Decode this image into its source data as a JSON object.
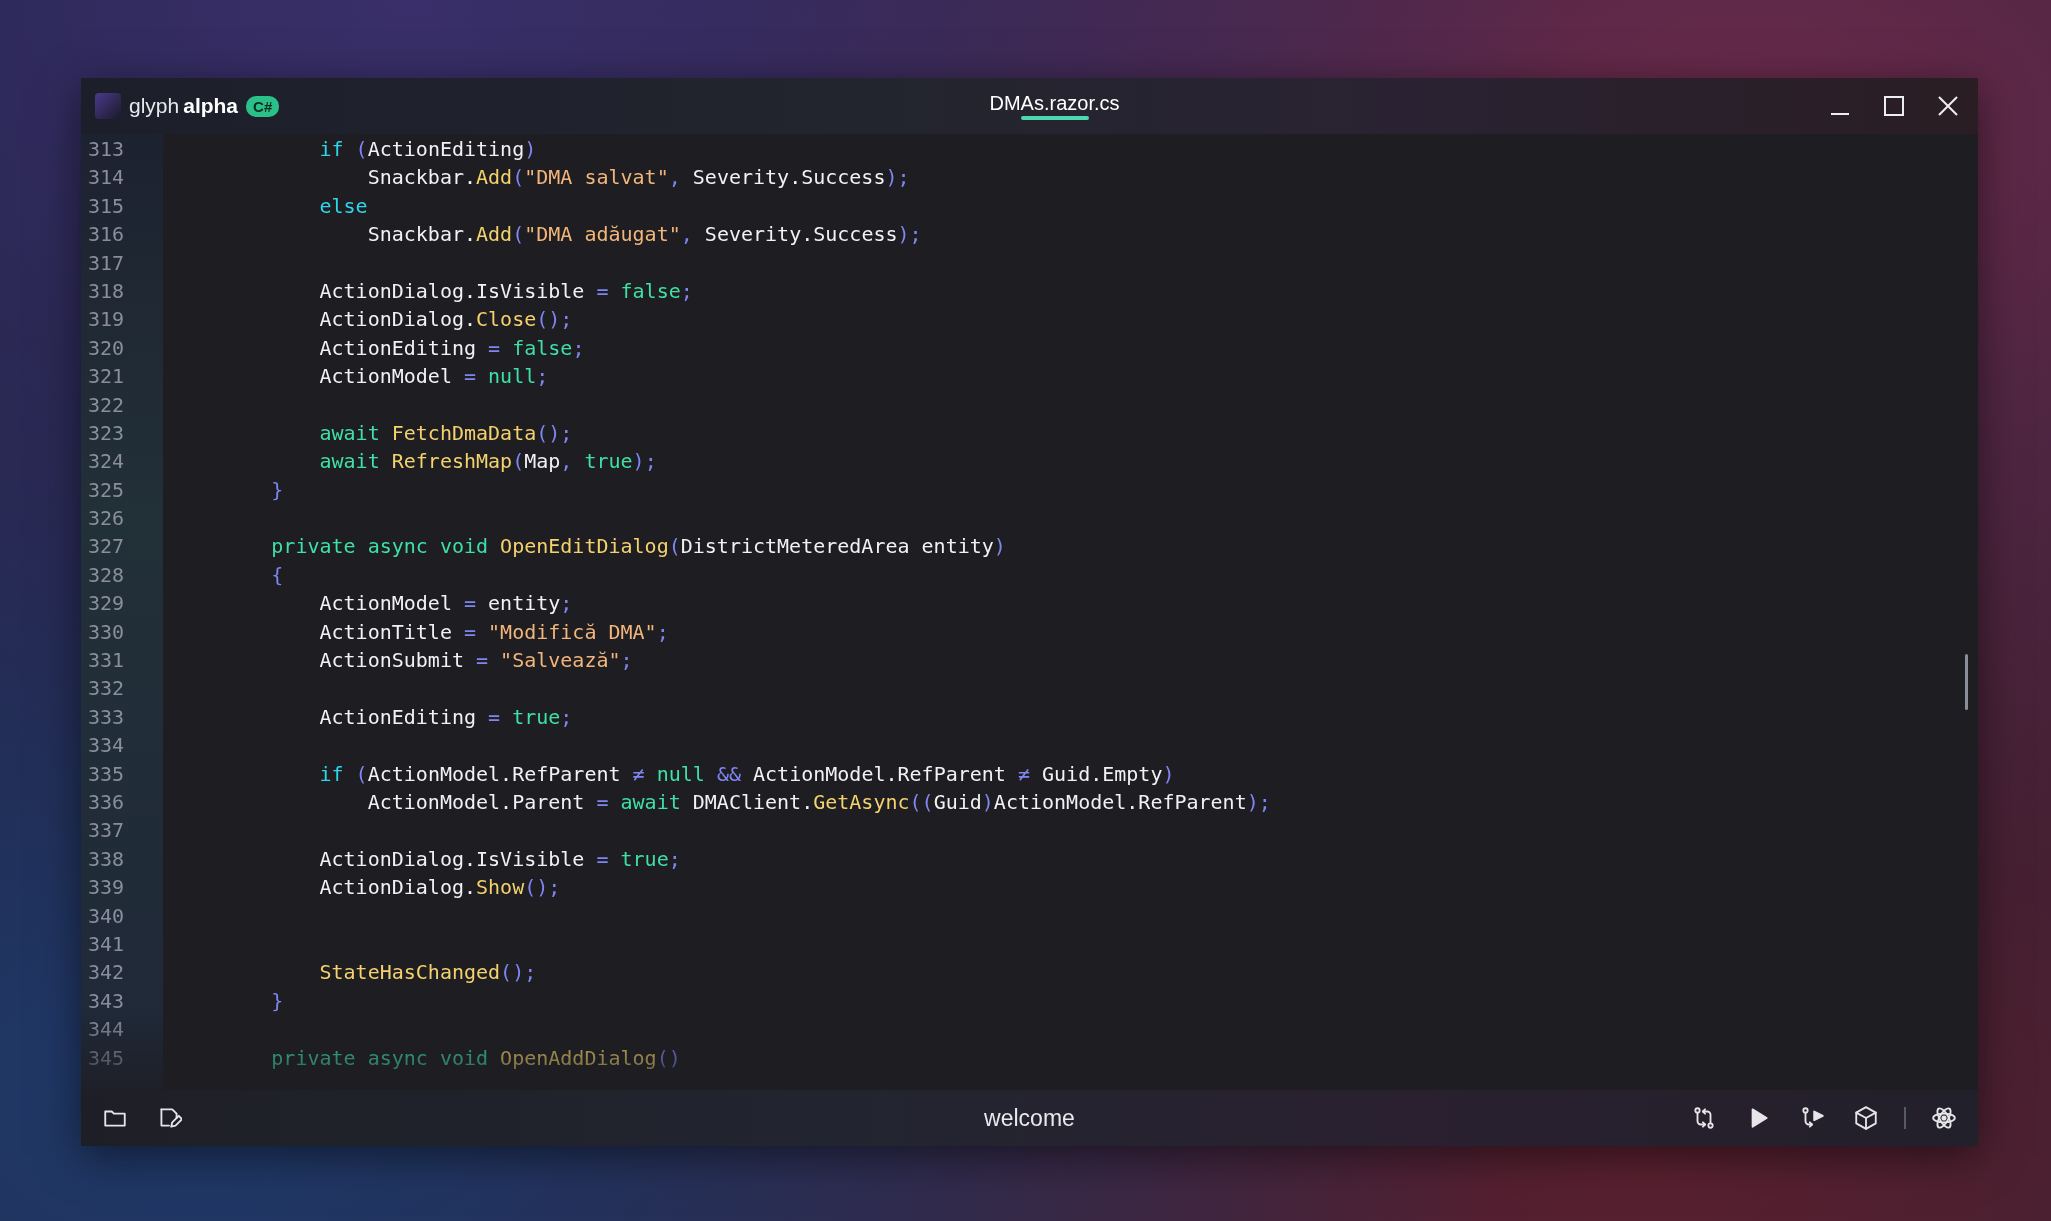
{
  "window": {
    "brand_name": "glyph",
    "brand_suffix": "alpha",
    "language_badge": "C#"
  },
  "tabs": [
    {
      "label": "DMAs.razor.cs",
      "selected": true
    }
  ],
  "code_lines": [
    {
      "number": "313",
      "tokens": [
        {
          "kind": "kw",
          "text": "            if"
        },
        {
          "kind": "punc",
          "text": " ("
        },
        {
          "kind": "plain",
          "text": "ActionEditing"
        },
        {
          "kind": "punc",
          "text": ")"
        }
      ]
    },
    {
      "number": "314",
      "tokens": [
        {
          "kind": "plain",
          "text": "                Snackbar."
        },
        {
          "kind": "fn",
          "text": "Add"
        },
        {
          "kind": "punc",
          "text": "("
        },
        {
          "kind": "str",
          "text": "\"DMA salvat\""
        },
        {
          "kind": "punc",
          "text": ", "
        },
        {
          "kind": "plain",
          "text": "Severity.Success"
        },
        {
          "kind": "punc",
          "text": ");"
        }
      ]
    },
    {
      "number": "315",
      "tokens": [
        {
          "kind": "kw",
          "text": "            else"
        }
      ]
    },
    {
      "number": "316",
      "tokens": [
        {
          "kind": "plain",
          "text": "                Snackbar."
        },
        {
          "kind": "fn",
          "text": "Add"
        },
        {
          "kind": "punc",
          "text": "("
        },
        {
          "kind": "str",
          "text": "\"DMA adăugat\""
        },
        {
          "kind": "punc",
          "text": ", "
        },
        {
          "kind": "plain",
          "text": "Severity.Success"
        },
        {
          "kind": "punc",
          "text": ");"
        }
      ]
    },
    {
      "number": "317"
    },
    {
      "number": "318",
      "tokens": [
        {
          "kind": "plain",
          "text": "            ActionDialog.IsVisible"
        },
        {
          "kind": "punc",
          "text": " = "
        },
        {
          "kind": "lit",
          "text": "false"
        },
        {
          "kind": "punc",
          "text": ";"
        }
      ]
    },
    {
      "number": "319",
      "tokens": [
        {
          "kind": "plain",
          "text": "            ActionDialog."
        },
        {
          "kind": "fn",
          "text": "Close"
        },
        {
          "kind": "punc",
          "text": "();"
        }
      ]
    },
    {
      "number": "320",
      "tokens": [
        {
          "kind": "plain",
          "text": "            ActionEditing"
        },
        {
          "kind": "punc",
          "text": " = "
        },
        {
          "kind": "lit",
          "text": "false"
        },
        {
          "kind": "punc",
          "text": ";"
        }
      ]
    },
    {
      "number": "321",
      "tokens": [
        {
          "kind": "plain",
          "text": "            ActionModel"
        },
        {
          "kind": "punc",
          "text": " = "
        },
        {
          "kind": "lit",
          "text": "null"
        },
        {
          "kind": "punc",
          "text": ";"
        }
      ]
    },
    {
      "number": "322"
    },
    {
      "number": "323",
      "tokens": [
        {
          "kind": "lit",
          "text": "            await "
        },
        {
          "kind": "fn",
          "text": "FetchDmaData"
        },
        {
          "kind": "punc",
          "text": "();"
        }
      ]
    },
    {
      "number": "324",
      "tokens": [
        {
          "kind": "lit",
          "text": "            await "
        },
        {
          "kind": "fn",
          "text": "RefreshMap"
        },
        {
          "kind": "punc",
          "text": "("
        },
        {
          "kind": "plain",
          "text": "Map"
        },
        {
          "kind": "punc",
          "text": ", "
        },
        {
          "kind": "lit",
          "text": "true"
        },
        {
          "kind": "punc",
          "text": ");"
        }
      ]
    },
    {
      "number": "325",
      "tokens": [
        {
          "kind": "punc",
          "text": "        }"
        }
      ]
    },
    {
      "number": "326"
    },
    {
      "number": "327",
      "tokens": [
        {
          "kind": "lit",
          "text": "        private async void "
        },
        {
          "kind": "fn",
          "text": "OpenEditDialog"
        },
        {
          "kind": "punc",
          "text": "("
        },
        {
          "kind": "plain",
          "text": "DistrictMeteredArea entity"
        },
        {
          "kind": "punc",
          "text": ")"
        }
      ]
    },
    {
      "number": "328",
      "tokens": [
        {
          "kind": "punc",
          "text": "        {"
        }
      ]
    },
    {
      "number": "329",
      "tokens": [
        {
          "kind": "plain",
          "text": "            ActionModel"
        },
        {
          "kind": "punc",
          "text": " = "
        },
        {
          "kind": "plain",
          "text": "entity"
        },
        {
          "kind": "punc",
          "text": ";"
        }
      ]
    },
    {
      "number": "330",
      "tokens": [
        {
          "kind": "plain",
          "text": "            ActionTitle"
        },
        {
          "kind": "punc",
          "text": " = "
        },
        {
          "kind": "str",
          "text": "\"Modifică DMA\""
        },
        {
          "kind": "punc",
          "text": ";"
        }
      ]
    },
    {
      "number": "331",
      "tokens": [
        {
          "kind": "plain",
          "text": "            ActionSubmit"
        },
        {
          "kind": "punc",
          "text": " = "
        },
        {
          "kind": "str",
          "text": "\"Salvează\""
        },
        {
          "kind": "punc",
          "text": ";"
        }
      ]
    },
    {
      "number": "332"
    },
    {
      "number": "333",
      "tokens": [
        {
          "kind": "plain",
          "text": "            ActionEditing"
        },
        {
          "kind": "punc",
          "text": " = "
        },
        {
          "kind": "lit",
          "text": "true"
        },
        {
          "kind": "punc",
          "text": ";"
        }
      ]
    },
    {
      "number": "334"
    },
    {
      "number": "335",
      "tokens": [
        {
          "kind": "kw",
          "text": "            if"
        },
        {
          "kind": "punc",
          "text": " ("
        },
        {
          "kind": "plain",
          "text": "ActionModel.RefParent"
        },
        {
          "kind": "punc",
          "text": " ≠ "
        },
        {
          "kind": "lit",
          "text": "null"
        },
        {
          "kind": "punc",
          "text": " && "
        },
        {
          "kind": "plain",
          "text": "ActionModel.RefParent"
        },
        {
          "kind": "punc",
          "text": " ≠ "
        },
        {
          "kind": "plain",
          "text": "Guid.Empty"
        },
        {
          "kind": "punc",
          "text": ")"
        }
      ]
    },
    {
      "number": "336",
      "tokens": [
        {
          "kind": "plain",
          "text": "                ActionModel.Parent"
        },
        {
          "kind": "punc",
          "text": " = "
        },
        {
          "kind": "lit",
          "text": "await "
        },
        {
          "kind": "plain",
          "text": "DMAClient."
        },
        {
          "kind": "fn",
          "text": "GetAsync"
        },
        {
          "kind": "punc",
          "text": "(("
        },
        {
          "kind": "plain",
          "text": "Guid"
        },
        {
          "kind": "punc",
          "text": ")"
        },
        {
          "kind": "plain",
          "text": "ActionModel.RefParent"
        },
        {
          "kind": "punc",
          "text": ");"
        }
      ]
    },
    {
      "number": "337"
    },
    {
      "number": "338",
      "tokens": [
        {
          "kind": "plain",
          "text": "            ActionDialog.IsVisible"
        },
        {
          "kind": "punc",
          "text": " = "
        },
        {
          "kind": "lit",
          "text": "true"
        },
        {
          "kind": "punc",
          "text": ";"
        }
      ]
    },
    {
      "number": "339",
      "tokens": [
        {
          "kind": "plain",
          "text": "            ActionDialog."
        },
        {
          "kind": "fn",
          "text": "Show"
        },
        {
          "kind": "punc",
          "text": "();"
        }
      ]
    },
    {
      "number": "340"
    },
    {
      "number": "341"
    },
    {
      "number": "342",
      "tokens": [
        {
          "kind": "fn",
          "text": "            StateHasChanged"
        },
        {
          "kind": "punc",
          "text": "();"
        }
      ]
    },
    {
      "number": "343",
      "tokens": [
        {
          "kind": "punc",
          "text": "        }"
        }
      ]
    },
    {
      "number": "344"
    },
    {
      "number": "345",
      "tokens": [
        {
          "kind": "lit",
          "text": "        private async void "
        },
        {
          "kind": "fn",
          "text": "OpenAddDialog"
        },
        {
          "kind": "punc",
          "text": "()"
        }
      ]
    }
  ],
  "status_bar": {
    "label": "welcome"
  }
}
